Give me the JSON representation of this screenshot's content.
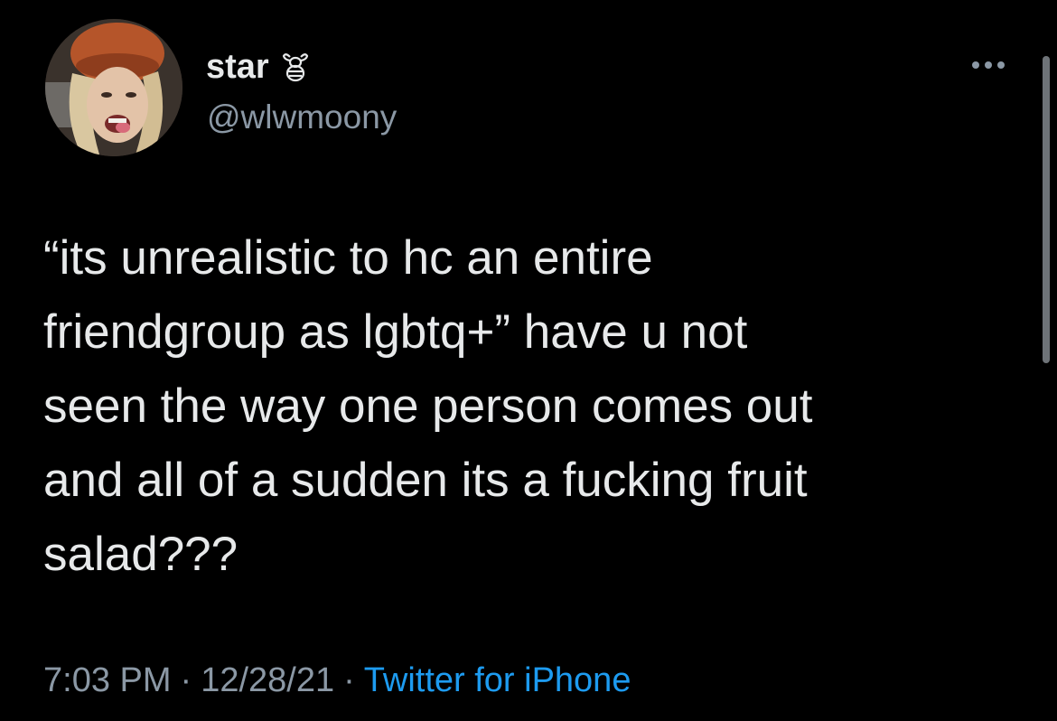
{
  "user": {
    "display_name": "star",
    "badge_icon": "bee-icon",
    "handle": "@wlwmoony"
  },
  "tweet": {
    "text": "“its unrealistic to hc an entire\nfriendgroup as lgbtq+” have u not\nseen the way one person comes out\nand all of a sudden its a fucking fruit\nsalad???"
  },
  "meta": {
    "time": "7:03 PM",
    "separator": "·",
    "date": "12/28/21",
    "source": "Twitter for iPhone"
  },
  "actions": {
    "more_icon": "more-options-icon"
  },
  "colors": {
    "background": "#000000",
    "primary_text": "#e7e9ea",
    "secondary_text": "#8b98a5",
    "link": "#1d9bf0"
  }
}
